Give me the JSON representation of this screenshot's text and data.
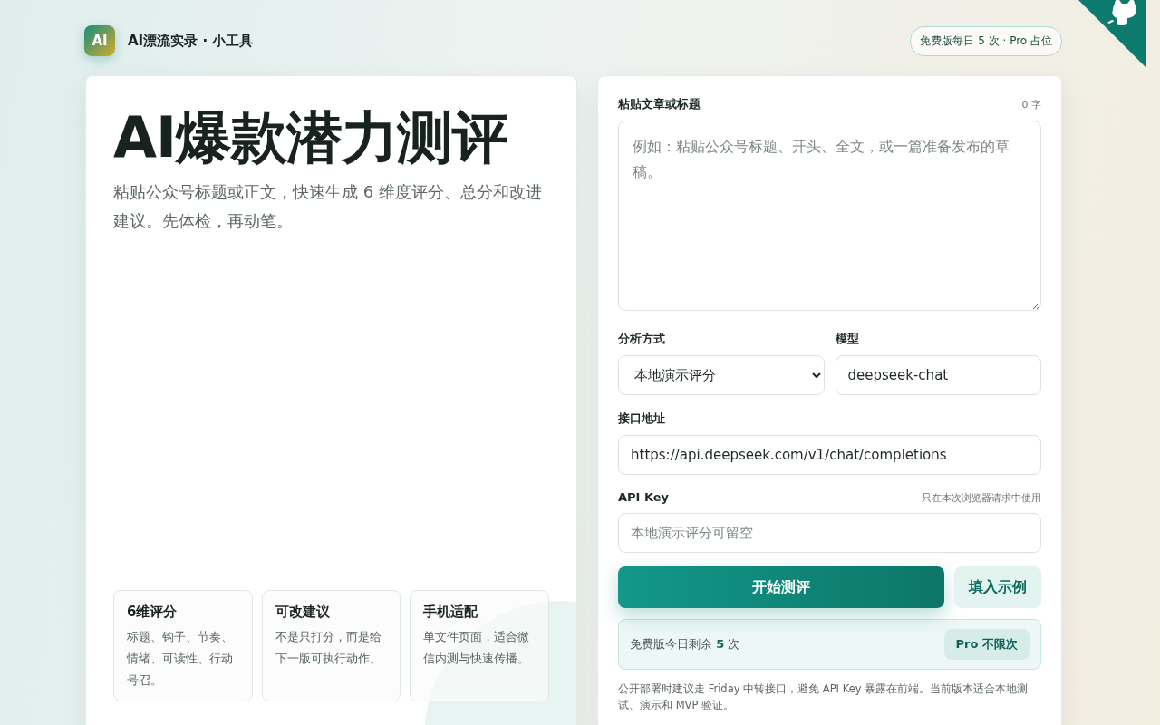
{
  "header": {
    "logo": "AI",
    "title": "AI漂流实录 · 小工具",
    "badge": "免费版每日 5 次 · Pro 占位"
  },
  "hero": {
    "title": "AI爆款潜力测评",
    "subtitle": "粘贴公众号标题或正文，快速生成 6 维度评分、总分和改进建议。先体检，再动笔。",
    "features": [
      {
        "title": "6维评分",
        "text": "标题、钩子、节奏、情绪、可读性、行动号召。"
      },
      {
        "title": "可改建议",
        "text": "不是只打分，而是给下一版可执行动作。"
      },
      {
        "title": "手机适配",
        "text": "单文件页面，适合微信内测与快速传播。"
      }
    ]
  },
  "form": {
    "article": {
      "label": "粘贴文章或标题",
      "count": "0 字",
      "placeholder": "例如：粘贴公众号标题、开头、全文，或一篇准备发布的草稿。"
    },
    "mode": {
      "label": "分析方式",
      "value": "本地演示评分"
    },
    "model": {
      "label": "模型",
      "value": "deepseek-chat"
    },
    "endpoint": {
      "label": "接口地址",
      "value": "https://api.deepseek.com/v1/chat/completions"
    },
    "api_key": {
      "label": "API Key",
      "hint": "只在本次浏览器请求中使用",
      "placeholder": "本地演示评分可留空"
    },
    "buttons": [
      {
        "label": "开始测评",
        "kind": "primary"
      },
      {
        "label": "填入示例",
        "kind": "secondary"
      }
    ],
    "quota": {
      "text": "免费版今日剩余 **5** 次",
      "button": "Pro 不限次"
    },
    "note": "公开部署时建议走 Friday 中转接口，避免 API Key 暴露在前端。当前版本适合本地测试、演示和 MVP 验证。"
  }
}
